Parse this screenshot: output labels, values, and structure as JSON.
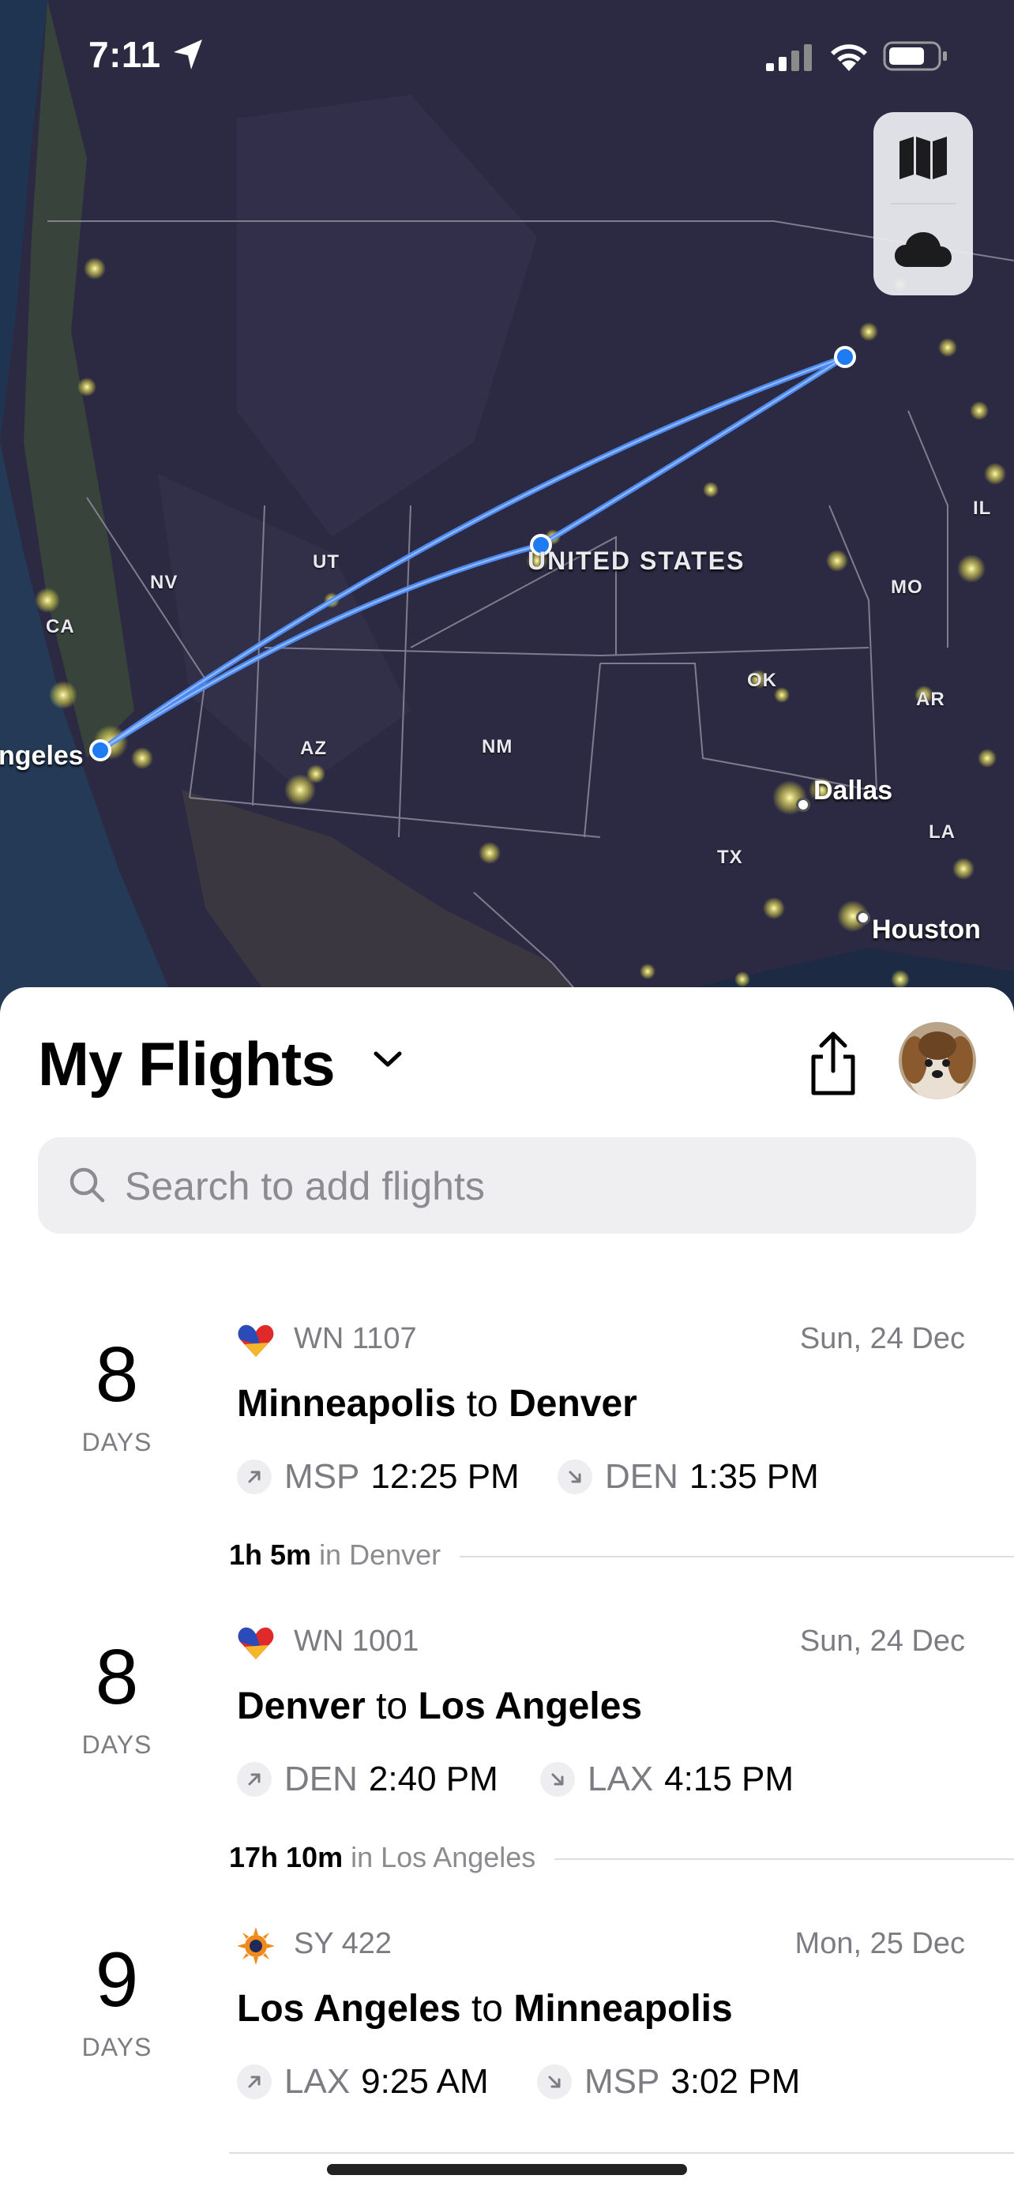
{
  "status_bar": {
    "time": "7:11"
  },
  "map": {
    "country_label": "UNITED STATES",
    "state_labels": [
      "NV",
      "CA",
      "UT",
      "AZ",
      "NM",
      "OK",
      "AR",
      "TX",
      "LA",
      "MO",
      "IL"
    ],
    "city_labels": [
      "ngeles",
      "Dallas",
      "Houston"
    ],
    "controls": {
      "map_mode_icon": "map-icon",
      "weather_icon": "cloud-icon"
    }
  },
  "sheet": {
    "title": "My Flights",
    "title_icon": "chevron-down-icon",
    "share_icon": "share-icon",
    "search_placeholder": "Search to add flights",
    "days_label": "DAYS",
    "connector": "to",
    "flights": [
      {
        "days": "8",
        "airline": "Southwest",
        "flight_no": "WN 1107",
        "date": "Sun, 24 Dec",
        "from_city": "Minneapolis",
        "to_city": "Denver",
        "dep_code": "MSP",
        "dep_time": "12:25 PM",
        "arr_code": "DEN",
        "arr_time": "1:35 PM"
      },
      {
        "days": "8",
        "airline": "Southwest",
        "flight_no": "WN 1001",
        "date": "Sun, 24 Dec",
        "from_city": "Denver",
        "to_city": "Los Angeles",
        "dep_code": "DEN",
        "dep_time": "2:40 PM",
        "arr_code": "LAX",
        "arr_time": "4:15 PM"
      },
      {
        "days": "9",
        "airline": "Sun Country",
        "flight_no": "SY 422",
        "date": "Mon, 25 Dec",
        "from_city": "Los Angeles",
        "to_city": "Minneapolis",
        "dep_code": "LAX",
        "dep_time": "9:25 AM",
        "arr_code": "MSP",
        "arr_time": "3:02 PM"
      }
    ],
    "layovers": [
      {
        "duration": "1h 5m",
        "in_text": "in Denver"
      },
      {
        "duration": "17h 10m",
        "in_text": "in Los Angeles"
      }
    ]
  },
  "colors": {
    "route": "#4f8ff7",
    "map_bg": "#2f2d45",
    "southwest_blue": "#2a4bb8",
    "southwest_red": "#e02a2a",
    "southwest_yellow": "#f6b62a",
    "sun_country_orange": "#f08a1c"
  }
}
